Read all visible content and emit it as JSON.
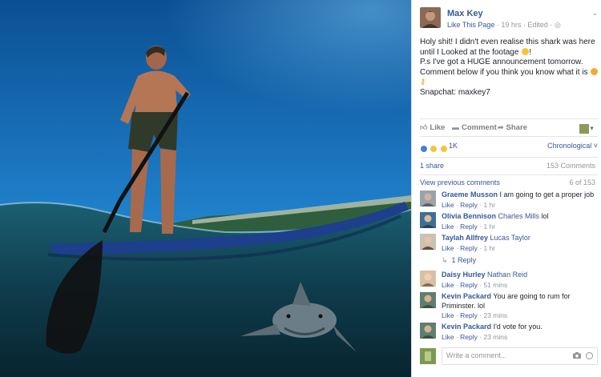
{
  "photo": {
    "description_icon": "shark-surf-photo"
  },
  "post": {
    "author": "Max Key",
    "meta_page": "Like This Page",
    "meta_rest": "· 19 hrs · Edited ·",
    "privacy_icon": "globe-icon",
    "menu_icon": "chevron-down-icon",
    "text_line1": "Holy shit! I didn't even realise this shark was here",
    "text_line2": "until I Looked at the footage",
    "text_line2_end": "!",
    "text_line3": "P.s I've got a HUGE announcement tomorrow.",
    "text_line4": "Comment below if you think you know what it is",
    "text_line6": "Snapchat: maxkey7"
  },
  "actions": {
    "like": "Like",
    "comment": "Comment",
    "share": "Share"
  },
  "reactions": {
    "count": "1K",
    "sort": "Chronological",
    "colors": [
      "#4a7bdc",
      "#f5c33b",
      "#f5c33b"
    ]
  },
  "shares": {
    "label": "1 share",
    "comments_total": "153 Comments"
  },
  "comments_nav": {
    "view_previous": "View previous comments",
    "range": "6 of 153"
  },
  "comments": [
    {
      "name": "Graeme Musson",
      "tag": "",
      "text": "I am going to get a proper job",
      "like": "Like",
      "reply": "Reply",
      "time": "1 hr"
    },
    {
      "name": "Olivia Bennison",
      "tag": "Charles Mills",
      "text": "lol",
      "like": "Like",
      "reply": "Reply",
      "time": "1 hr"
    },
    {
      "name": "Taylah Allfrey",
      "tag": "Lucas Taylor",
      "text": "",
      "like": "Like",
      "reply": "Reply",
      "time": "1 hr"
    },
    {
      "name": "Daisy Hurley",
      "tag": "Nathan Reid",
      "text": "",
      "like": "Like",
      "reply": "Reply",
      "time": "51 mins"
    },
    {
      "name": "Kevin Packard",
      "tag": "",
      "text": "You are going to rum for Priminster. lol",
      "like": "Like",
      "reply": "Reply",
      "time": "23 mins"
    },
    {
      "name": "Kevin Packard",
      "tag": "",
      "text": "I'd vote for you.",
      "like": "Like",
      "reply": "Reply",
      "time": "23 mins"
    }
  ],
  "reply_link": "1 Reply",
  "write": {
    "placeholder": "Write a comment..."
  },
  "colors": {
    "link": "#365899",
    "muted": "#90949c",
    "text": "#1d2129"
  }
}
